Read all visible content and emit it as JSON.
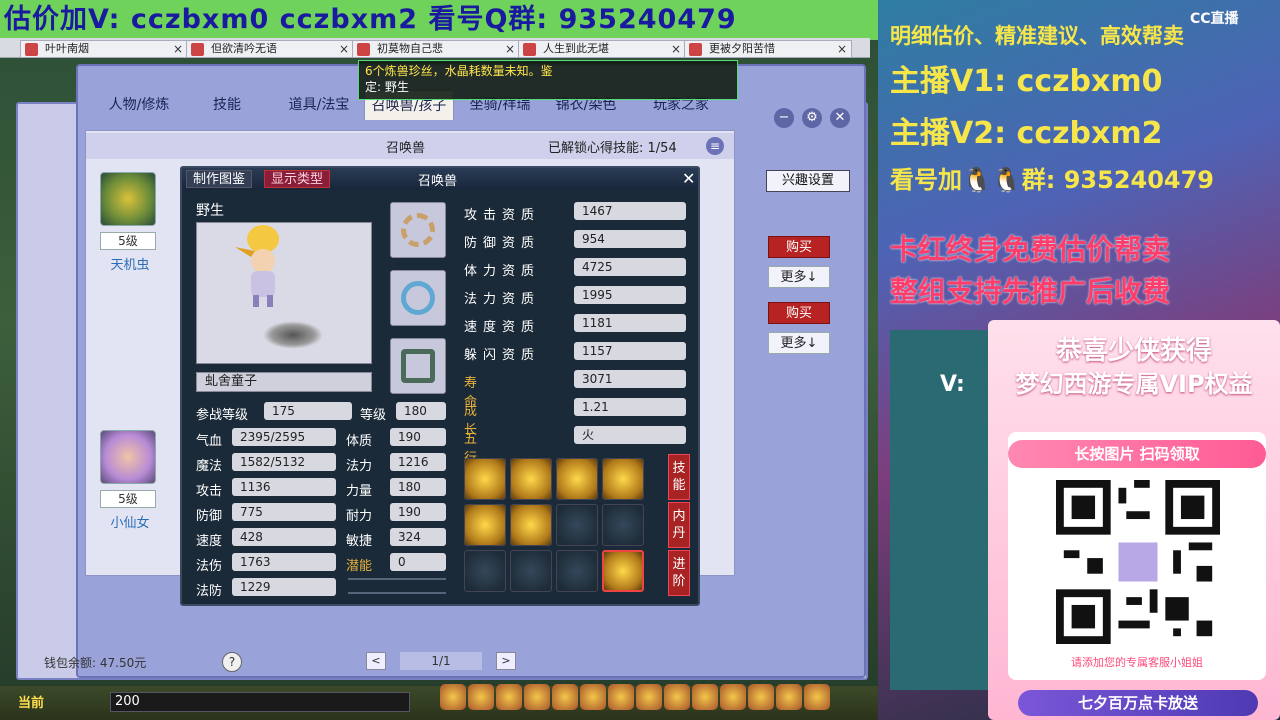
{
  "banner": {
    "text": "估价加V:  cczbxm0   cczbxm2   看号Q群: 935240479"
  },
  "browser_tabs": [
    "叶叶南烟",
    "但欲清吟无语",
    "初莫物自己悲",
    "人生到此无堪",
    "更被夕阳苦惜"
  ],
  "notice": {
    "text": "6个炼兽珍丝，水晶耗数量未知。鉴",
    "who": "定: 野生"
  },
  "shop_tabs": [
    "人物/修炼",
    "技能",
    "道具/法宝",
    "召唤兽/孩子",
    "坐骑/祥瑞",
    "锦衣/染色",
    "玩家之家"
  ],
  "active_tab_index": 3,
  "panel": {
    "title": "召唤兽",
    "unlock_label": "已解锁心得技能:",
    "unlock_value": "1/54",
    "fun_settings": "兴趣设置"
  },
  "left_list": [
    {
      "level": "5级",
      "name": "天机虫"
    },
    {
      "level": "5级",
      "name": "小仙女"
    }
  ],
  "right_buttons": {
    "buy": "购买",
    "more": "更多↓"
  },
  "popup": {
    "header_btn_1": "制作图鉴",
    "header_btn_2": "显示类型",
    "title": "召唤兽",
    "close": "✕",
    "wild": "野生",
    "pet_name": "虬舍童子",
    "battle_level_label": "参战等级",
    "battle_level": "175",
    "level_label": "等级",
    "level": "180",
    "stats_left": [
      {
        "label": "气血",
        "value": "2395/2595"
      },
      {
        "label": "魔法",
        "value": "1582/5132"
      },
      {
        "label": "攻击",
        "value": "1136"
      },
      {
        "label": "防御",
        "value": "775"
      },
      {
        "label": "速度",
        "value": "428"
      },
      {
        "label": "法伤",
        "value": "1763"
      },
      {
        "label": "法防",
        "value": "1229"
      }
    ],
    "stats_right": [
      {
        "label": "体质",
        "value": "190"
      },
      {
        "label": "法力",
        "value": "1216"
      },
      {
        "label": "力量",
        "value": "180"
      },
      {
        "label": "耐力",
        "value": "190"
      },
      {
        "label": "敏捷",
        "value": "324"
      },
      {
        "label": "潜能",
        "value": "0"
      }
    ],
    "aptitudes": [
      {
        "label": "攻击资质",
        "value": "1467"
      },
      {
        "label": "防御资质",
        "value": "954"
      },
      {
        "label": "体力资质",
        "value": "4725"
      },
      {
        "label": "法力资质",
        "value": "1995"
      },
      {
        "label": "速度资质",
        "value": "1181"
      },
      {
        "label": "躲闪资质",
        "value": "1157"
      },
      {
        "label": "寿命",
        "value": "3071"
      },
      {
        "label": "成长",
        "value": "1.21"
      },
      {
        "label": "五行",
        "value": "火"
      }
    ],
    "side_tabs": [
      "技能",
      "内丹",
      "进阶"
    ]
  },
  "wallet": "钱包余额: 47.50元",
  "help": "?",
  "pager": {
    "text": "1/1",
    "prev": "<",
    "next": ">"
  },
  "bottom": {
    "current": "当前",
    "input_value": "200"
  },
  "stream": {
    "line1": "明细估价、精准建议、高效帮卖",
    "line2": "主播V1: cczbxm0",
    "line3": "主播V2: cczbxm2",
    "line4": "看号加🐧🐧群: 935240479",
    "line5": "卡红终身免费估价帮卖",
    "line6": "整组支持先推广后收费",
    "cc_logo": "CC直播",
    "promo_title": "恭喜少侠获得",
    "promo_sub": "梦幻西游专属VIP权益",
    "promo_scan": "长按图片 扫码领取",
    "promo_note": "请添加您的专属客服小姐姐",
    "promo_foot": "七夕百万点卡放送",
    "v_label": "V:"
  },
  "colors": {
    "banner_bg": "#6fd25b",
    "banner_text": "#1a1aa0",
    "buy_red": "#b72323",
    "gold": "#e8b23a",
    "stream_yellow": "#f7e64a"
  }
}
